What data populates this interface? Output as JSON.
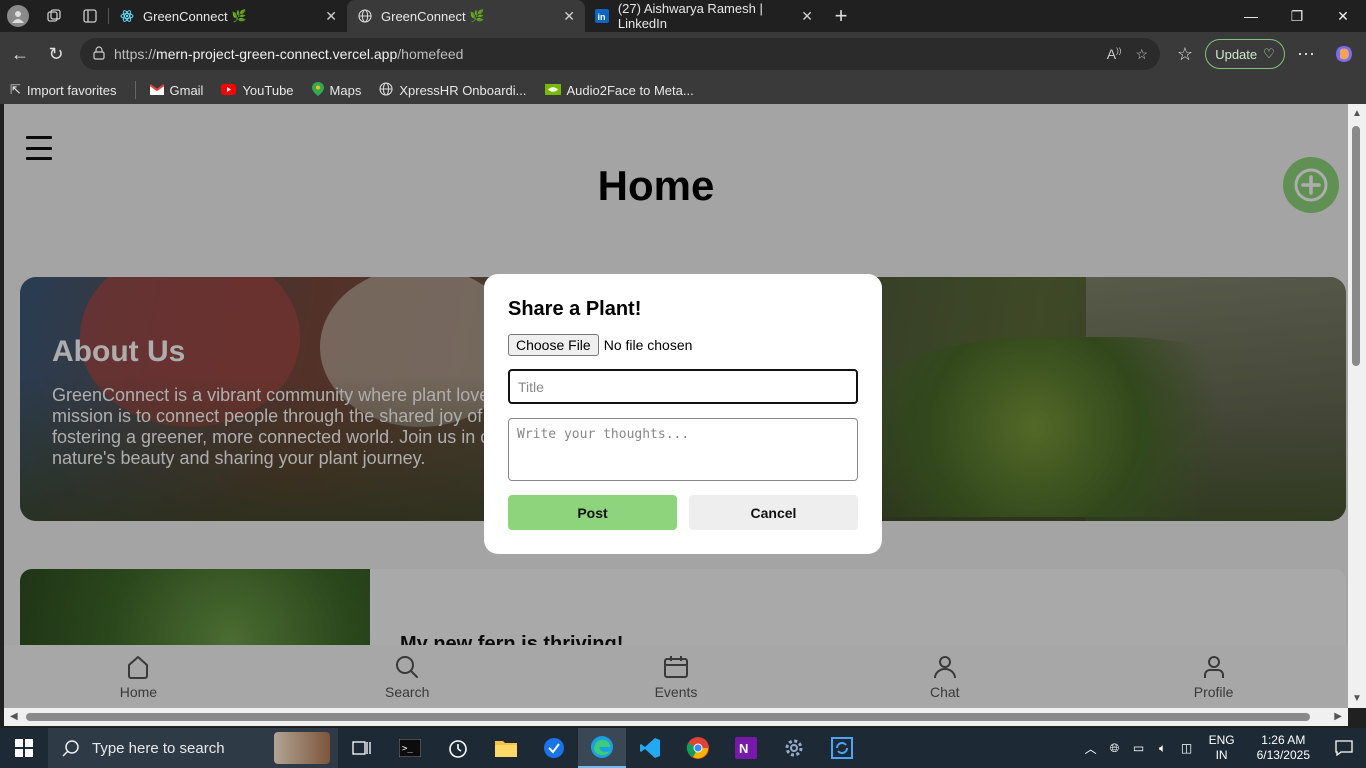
{
  "browser": {
    "tabs": [
      {
        "label": "GreenConnect",
        "active": false
      },
      {
        "label": "GreenConnect",
        "active": true
      },
      {
        "label": "(27) Aishwarya Ramesh | LinkedIn",
        "active": false
      }
    ],
    "url_scheme": "https://",
    "url_host": "mern-project-green-connect.vercel.app",
    "url_path": "/homefeed",
    "update_label": "Update",
    "favorites": [
      "Import favorites",
      "Gmail",
      "YouTube",
      "Maps",
      "XpressHR Onboardi...",
      "Audio2Face to Meta..."
    ]
  },
  "page": {
    "title": "Home",
    "about": {
      "heading": "About Us",
      "text_lines": [
        "GreenConnect is a vibrant community where plant love",
        "mission is to connect people through the shared joy of",
        "fostering a greener, more connected world. Join us in c",
        "nature's beauty and sharing your plant journey."
      ]
    },
    "post": {
      "title": "My new fern is thriving!"
    },
    "bottom_nav": [
      "Home",
      "Search",
      "Events",
      "Chat",
      "Profile"
    ]
  },
  "modal": {
    "title": "Share a Plant!",
    "file_button": "Choose File",
    "file_status": "No file chosen",
    "title_placeholder": "Title",
    "thoughts_placeholder": "Write your thoughts...",
    "post_label": "Post",
    "cancel_label": "Cancel"
  },
  "taskbar": {
    "search_placeholder": "Type here to search",
    "lang_top": "ENG",
    "lang_bottom": "IN",
    "time": "1:26 AM",
    "date": "6/13/2025"
  },
  "colors": {
    "accent_green": "#8ed47c",
    "taskbar": "#1d2a36"
  }
}
